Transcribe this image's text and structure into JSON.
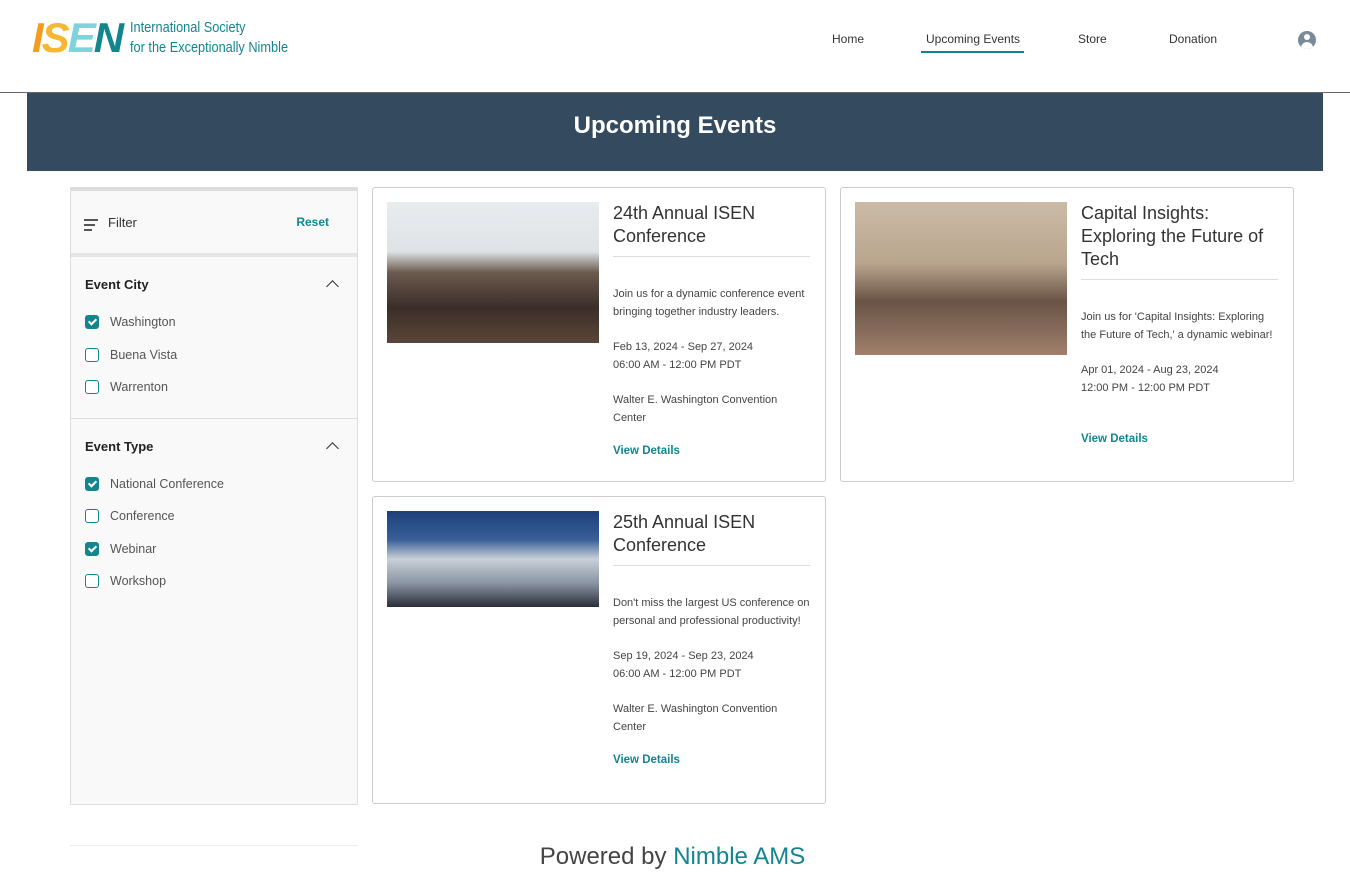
{
  "header": {
    "logo_mark": "ISEN",
    "logo_line1": "International Society",
    "logo_line2": "for the Exceptionally Nimble",
    "nav": [
      {
        "label": "Home"
      },
      {
        "label": "Upcoming Events",
        "active": true
      },
      {
        "label": "Store"
      },
      {
        "label": "Donation"
      }
    ],
    "user_icon": "user-avatar-icon"
  },
  "banner": {
    "title": "Upcoming Events"
  },
  "sidebar": {
    "filter_label": "Filter",
    "reset_label": "Reset",
    "sections": [
      {
        "title": "Event City",
        "options": [
          {
            "label": "Washington",
            "checked": true
          },
          {
            "label": "Buena Vista",
            "checked": false
          },
          {
            "label": "Warrenton",
            "checked": false
          }
        ]
      },
      {
        "title": "Event Type",
        "options": [
          {
            "label": "National Conference",
            "checked": true
          },
          {
            "label": "Conference",
            "checked": false
          },
          {
            "label": "Webinar",
            "checked": true
          },
          {
            "label": "Workshop",
            "checked": false
          }
        ]
      }
    ]
  },
  "events": [
    {
      "title": "24th Annual ISEN Conference",
      "description": "Join us for a dynamic conference event bringing together industry leaders.",
      "dates": "Feb 13, 2024 - Sep 27, 2024",
      "times": "06:00 AM - 12:00 PM PDT",
      "location": "Walter E. Washington Convention Center",
      "link": "View Details"
    },
    {
      "title": "Capital Insights: Exploring the Future of Tech",
      "description": "Join us for 'Capital Insights: Exploring the Future of Tech,' a dynamic webinar!",
      "dates": "Apr 01, 2024 - Aug 23, 2024",
      "times": "12:00 PM - 12:00 PM PDT",
      "location": "",
      "link": "View Details"
    },
    {
      "title": "25th Annual ISEN Conference",
      "description": "Don't miss the largest US conference on personal and professional productivity!",
      "dates": "Sep 19, 2024 - Sep 23, 2024",
      "times": "06:00 AM - 12:00 PM PDT",
      "location": "Walter E. Washington Convention Center",
      "link": "View Details"
    }
  ],
  "footer": {
    "prefix": "Powered by",
    "brand": "Nimble AMS"
  }
}
